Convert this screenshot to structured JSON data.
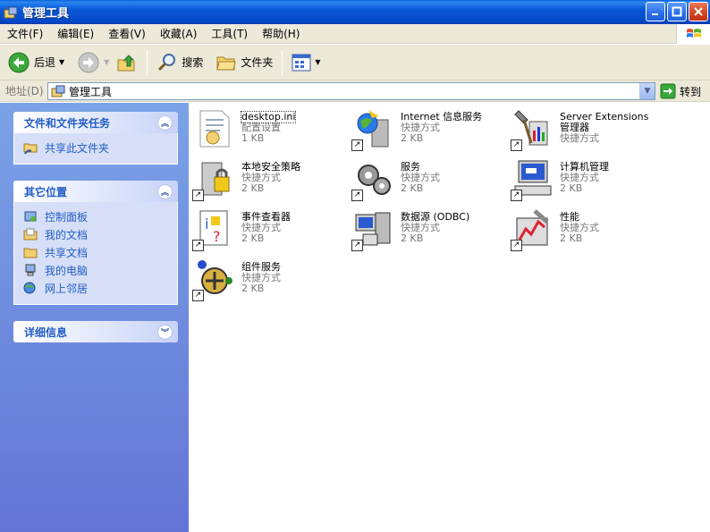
{
  "window": {
    "title": "管理工具"
  },
  "menu": [
    {
      "label": "文件(F)"
    },
    {
      "label": "编辑(E)"
    },
    {
      "label": "查看(V)"
    },
    {
      "label": "收藏(A)"
    },
    {
      "label": "工具(T)"
    },
    {
      "label": "帮助(H)"
    }
  ],
  "toolbar": {
    "back_label": "后退",
    "search_label": "搜索",
    "folders_label": "文件夹"
  },
  "address": {
    "label": "地址(D)",
    "value": "管理工具",
    "go_label": "转到"
  },
  "left_panels": [
    {
      "title": "文件和文件夹任务",
      "links": [
        {
          "label": "共享此文件夹"
        }
      ]
    },
    {
      "title": "其它位置",
      "links": [
        {
          "label": "控制面板"
        },
        {
          "label": "我的文档"
        },
        {
          "label": "共享文档"
        },
        {
          "label": "我的电脑"
        },
        {
          "label": "网上邻居"
        }
      ]
    },
    {
      "title": "详细信息",
      "links": []
    }
  ],
  "files": [
    {
      "name": "desktop.ini",
      "type": "配置设置",
      "size": "1 KB",
      "icon": "ini-file-icon"
    },
    {
      "name": "Internet 信息服务",
      "type": "快捷方式",
      "size": "2 KB",
      "icon": "iis-icon"
    },
    {
      "name": "Server Extensions",
      "name2": "管理器",
      "type": "快捷方式",
      "icon": "server-extensions-icon"
    },
    {
      "name": "本地安全策略",
      "type": "快捷方式",
      "size": "2 KB",
      "icon": "security-policy-icon"
    },
    {
      "name": "服务",
      "type": "快捷方式",
      "size": "2 KB",
      "icon": "services-icon"
    },
    {
      "name": "计算机管理",
      "type": "快捷方式",
      "size": "2 KB",
      "icon": "computer-management-icon"
    },
    {
      "name": "事件查看器",
      "type": "快捷方式",
      "size": "2 KB",
      "icon": "event-viewer-icon"
    },
    {
      "name": "数据源 (ODBC)",
      "type": "快捷方式",
      "size": "2 KB",
      "icon": "odbc-icon"
    },
    {
      "name": "性能",
      "type": "快捷方式",
      "size": "2 KB",
      "icon": "performance-icon"
    },
    {
      "name": "组件服务",
      "type": "快捷方式",
      "size": "2 KB",
      "icon": "component-services-icon"
    }
  ]
}
